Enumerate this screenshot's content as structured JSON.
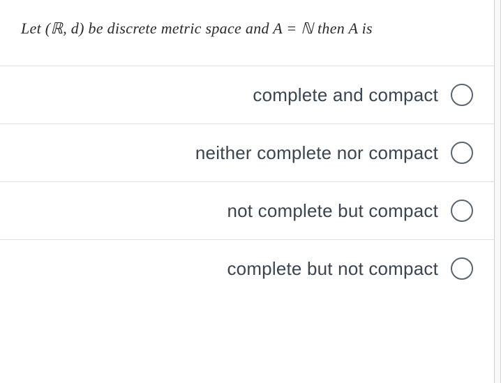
{
  "question": {
    "prefix": "Let  (",
    "set_symbol": "ℝ",
    "mid1": ", d)  be discrete metric space and A = ",
    "nat_symbol": "ℕ",
    "suffix": " then A is"
  },
  "options": [
    {
      "label": "complete and compact",
      "selected": false
    },
    {
      "label": "neither complete nor compact",
      "selected": false
    },
    {
      "label": "not complete but compact",
      "selected": false
    },
    {
      "label": "complete but not compact",
      "selected": false
    }
  ]
}
